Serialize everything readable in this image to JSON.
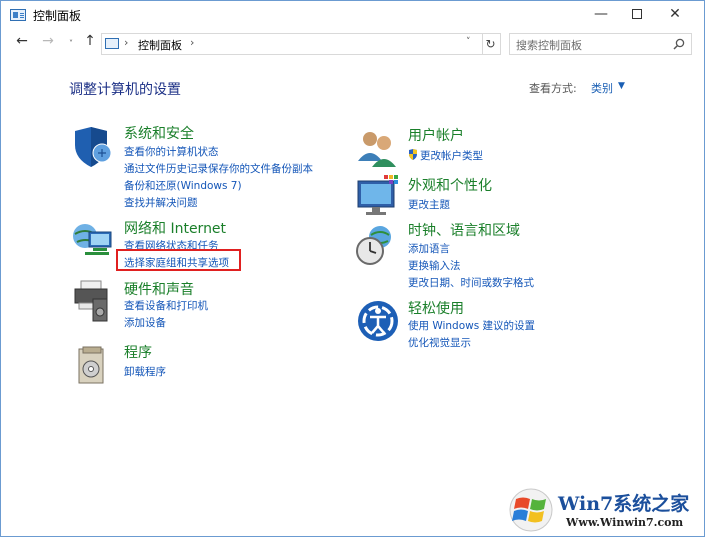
{
  "window": {
    "title": "控制面板",
    "controls": {
      "minimize": "—",
      "close": "✕"
    }
  },
  "address_bar": {
    "crumb": "控制面板",
    "separator": "›",
    "search_placeholder": "搜索控制面板",
    "nav": {
      "back": "←",
      "forward": "→",
      "recent": "˅",
      "up": "↑",
      "dropdown": "˅",
      "refresh": "↻"
    }
  },
  "main": {
    "heading": "调整计算机的设置",
    "view_by_label": "查看方式:",
    "view_by_value": "类别",
    "view_by_arrow": "▼"
  },
  "categories": [
    {
      "title": "系统和安全",
      "links": [
        "查看你的计算机状态",
        "通过文件历史记录保存你的文件备份副本",
        "备份和还原(Windows 7)",
        "查找并解决问题"
      ],
      "icon": "shield-icon"
    },
    {
      "title": "网络和 Internet",
      "links": [
        "查看网络状态和任务",
        "选择家庭组和共享选项"
      ],
      "icon": "network-globe-icon"
    },
    {
      "title": "硬件和声音",
      "links": [
        "查看设备和打印机",
        "添加设备"
      ],
      "icon": "printer-icon"
    },
    {
      "title": "程序",
      "links": [
        "卸载程序"
      ],
      "icon": "programs-icon"
    },
    {
      "title": "用户帐户",
      "links": [
        "更改帐户类型"
      ],
      "icon": "users-icon"
    },
    {
      "title": "外观和个性化",
      "links": [
        "更改主题"
      ],
      "icon": "monitor-palette-icon"
    },
    {
      "title": "时钟、语言和区域",
      "links": [
        "添加语言",
        "更换输入法",
        "更改日期、时间或数字格式"
      ],
      "icon": "clock-globe-icon"
    },
    {
      "title": "轻松使用",
      "links": [
        "使用 Windows 建议的设置",
        "优化视觉显示"
      ],
      "icon": "ease-of-access-icon"
    }
  ],
  "watermark": {
    "title": "Win7系统之家",
    "url": "Www.Winwin7.com"
  },
  "colors": {
    "category_title": "#1a7f2a",
    "link": "#1456b8",
    "heading": "#1e3287",
    "highlight": "#e02020"
  }
}
